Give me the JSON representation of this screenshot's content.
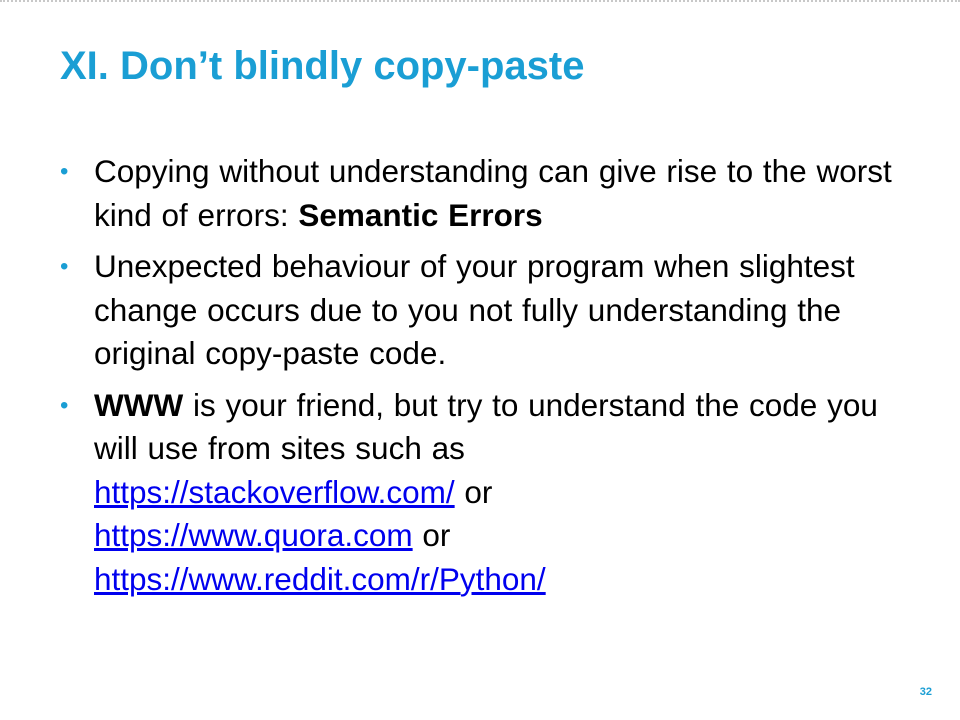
{
  "colors": {
    "title": "#1a9ed4",
    "bullet": "#1a9ed4",
    "link": "#0000ee",
    "page_number": "#1a9ed4"
  },
  "slide": {
    "title": "XI. Don’t blindly copy-paste",
    "bullet_glyph": "•",
    "bullets": [
      {
        "text_1": "Copying without understanding can give rise to the worst kind of errors: ",
        "bold_1": "Semantic Errors"
      },
      {
        "text_1": "Unexpected behaviour of your program when slightest change occurs due to you not fully understanding the original copy-paste code."
      },
      {
        "bold_1": "WWW",
        "text_1": " is your friend, but try to understand the code you will use from sites such as",
        "link_1": "https://stackoverflow.com/",
        "text_2": " or",
        "link_2": "https://www.quora.com",
        "text_3": " or",
        "link_3": "https://www.reddit.com/r/Python/"
      }
    ],
    "page_number": "32"
  }
}
